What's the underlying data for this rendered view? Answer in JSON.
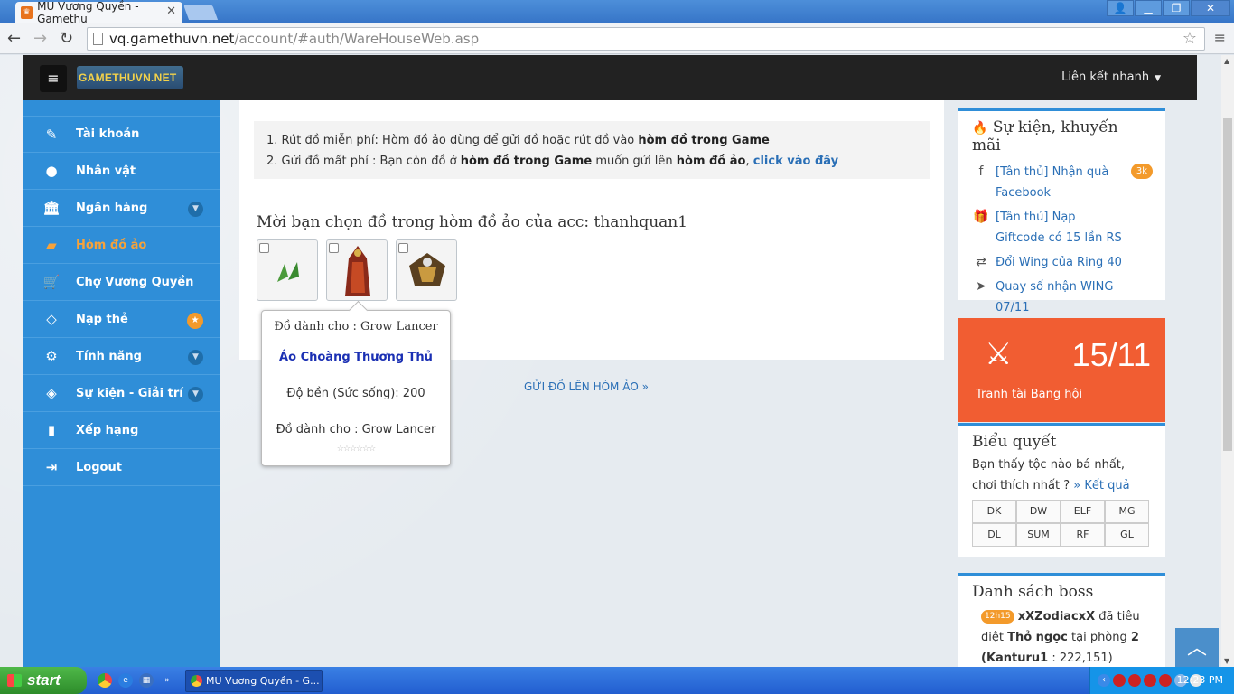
{
  "browser": {
    "tab_title": "MU Vương Quyền - Gamethu",
    "tab_close": "✕",
    "url_host": "vq.gamethuvn.net",
    "url_path": "/account/#auth/WareHouseWeb.asp"
  },
  "topnav": {
    "logo_text": "GAMETHUVN.NET",
    "quick_link": "Liên kết nhanh"
  },
  "sidebar": {
    "items": [
      {
        "label": "Tài khoản",
        "icon": "edit-icon"
      },
      {
        "label": "Nhân vật",
        "icon": "user-icon"
      },
      {
        "label": "Ngân hàng",
        "icon": "bank-icon"
      },
      {
        "label": "Hòm đồ ảo",
        "icon": "briefcase-icon"
      },
      {
        "label": "Chợ Vương Quyền",
        "icon": "cart-icon"
      },
      {
        "label": "Nạp thẻ",
        "icon": "diamond-icon"
      },
      {
        "label": "Tính năng",
        "icon": "cogs-icon"
      },
      {
        "label": "Sự kiện - Giải trí",
        "icon": "dice-icon"
      },
      {
        "label": "Xếp hạng",
        "icon": "chart-icon"
      },
      {
        "label": "Logout",
        "icon": "logout-icon"
      }
    ]
  },
  "main": {
    "info1_pre": "1. Rút đồ miễn phí: Hòm đồ ảo dùng để gửi đồ hoặc rút đồ vào ",
    "info1_bold": "hòm đồ trong Game",
    "info2_pre": "2. Gửi đồ mất phí : Bạn còn đồ ở ",
    "info2_bold1": "hòm đồ trong Game",
    "info2_mid": " muốn gửi lên ",
    "info2_bold2": "hòm đồ ảo",
    "info2_comma": ", ",
    "info2_link": "click vào đây",
    "heading": "Mời bạn chọn đồ trong hòm đồ ảo của acc: thanhquan1",
    "send_link": "GỬI ĐỒ LÊN HÒM ẢO  »"
  },
  "tooltip": {
    "line1": "Đồ dành cho : Grow Lancer",
    "item_name": "Áo Choàng Thương Thủ",
    "durability": "Độ bền (Sức sống): 200",
    "line4": "Đồ dành cho : Grow Lancer",
    "stars": "☆☆☆☆☆☆"
  },
  "events": {
    "title": "Sự kiện, khuyến mãi",
    "items": [
      {
        "label": "[Tân thủ] Nhận quà Facebook",
        "badge": "3k"
      },
      {
        "label": "[Tân thủ] Nạp Giftcode có 15 lần RS"
      },
      {
        "label": "Đổi Wing của Ring 40"
      },
      {
        "label": "Quay số nhận WING 07/11"
      }
    ]
  },
  "banner": {
    "date": "15/11",
    "text": "Tranh tài Bang hội"
  },
  "vote": {
    "title": "Biểu quyết",
    "question": "Bạn thấy tộc nào bá nhất, chơi thích nhất ?",
    "result_link": "» Kết quả",
    "options": [
      "DK",
      "DW",
      "ELF",
      "MG",
      "DL",
      "SUM",
      "RF",
      "GL"
    ]
  },
  "boss": {
    "title": "Danh sách boss",
    "time_badge": "12h15",
    "player": "xXZodiacxX",
    "text1": " đã tiêu diệt ",
    "boss_name": "Thỏ ngọc",
    "text2": " tại phòng ",
    "room": "2",
    "location": "(Kanturu1",
    "coords": " : 222,151)"
  },
  "taskbar": {
    "start": "start",
    "task_item": "MU Vương Quyền - G...",
    "time": "12:23 PM"
  }
}
